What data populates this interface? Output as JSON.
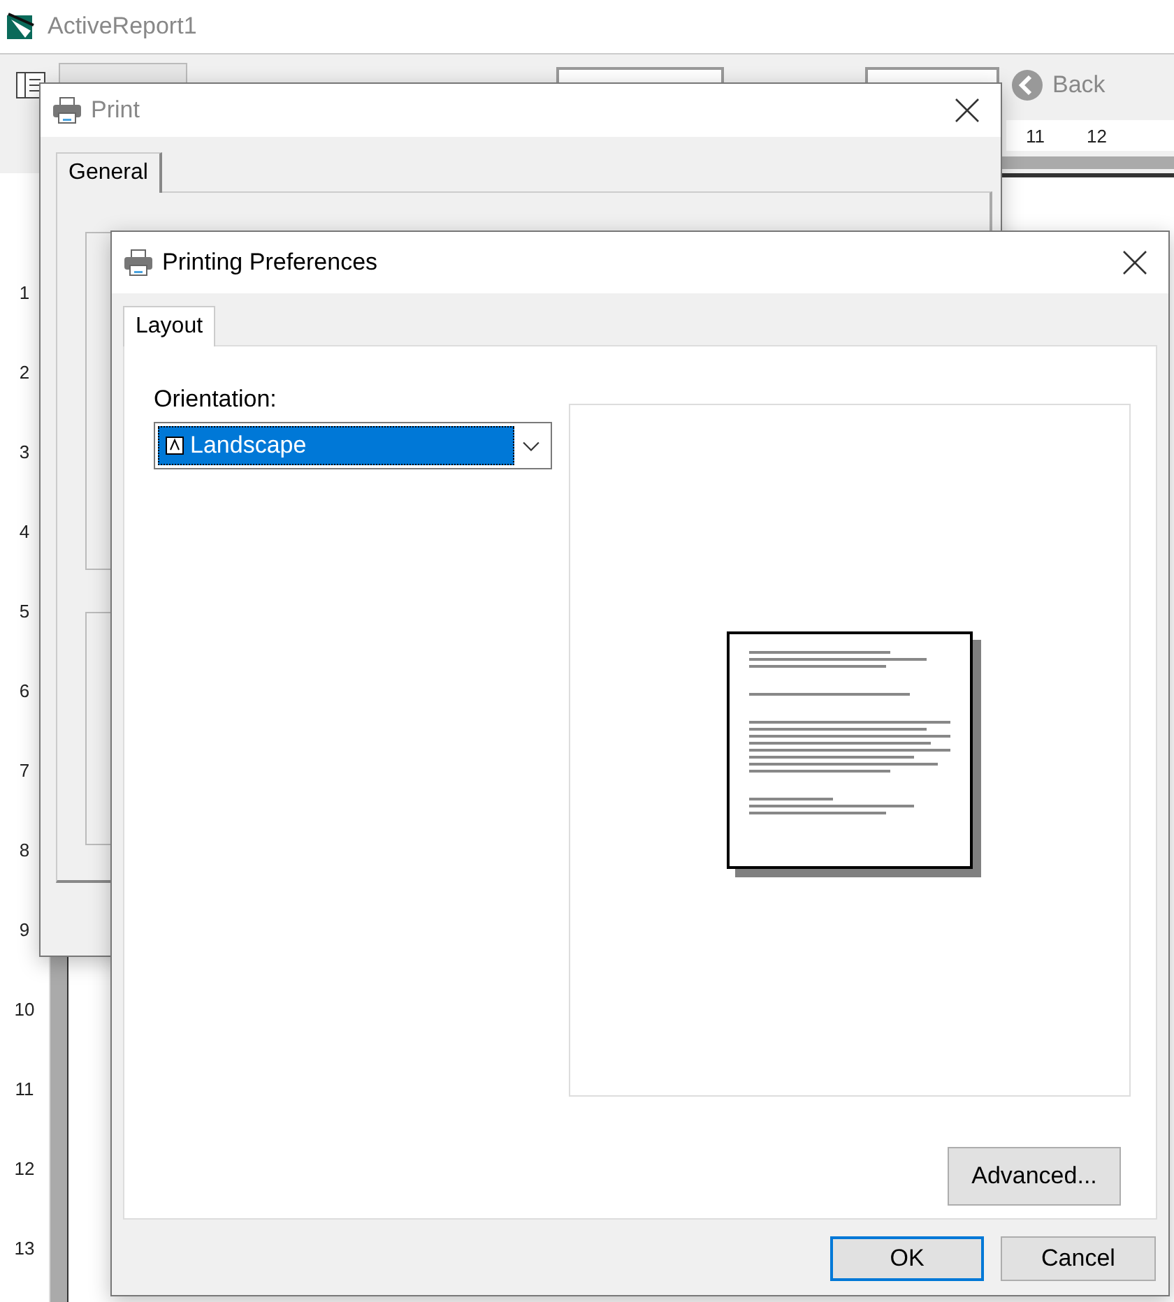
{
  "app_window": {
    "title": "ActiveReport1"
  },
  "toolbar": {
    "back_button": "Back"
  },
  "horizontal_ruler": [
    "11",
    "12"
  ],
  "vertical_ruler": [
    "1",
    "2",
    "3",
    "4",
    "5",
    "6",
    "7",
    "8",
    "9",
    "10",
    "11",
    "12",
    "13"
  ],
  "print_dialog": {
    "title": "Print",
    "tabs": [
      {
        "label": "General",
        "selected": true
      }
    ]
  },
  "preferences_dialog": {
    "title": "Printing Preferences",
    "tabs": [
      {
        "label": "Layout",
        "selected": true
      }
    ],
    "orientation_label": "Orientation:",
    "orientation_value": "Landscape",
    "advanced_button": "Advanced...",
    "buttons": [
      {
        "label": "OK",
        "default": true
      },
      {
        "label": "Cancel",
        "default": false
      }
    ]
  }
}
